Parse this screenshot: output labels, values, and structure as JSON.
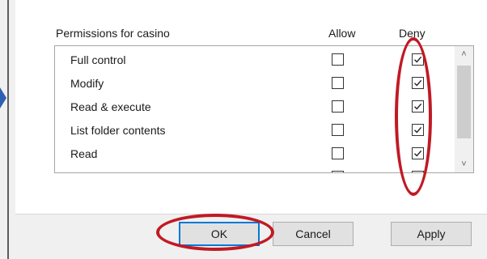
{
  "permissions": {
    "title": "Permissions for casino",
    "allow_header": "Allow",
    "deny_header": "Deny",
    "rows": [
      {
        "name": "Full control",
        "allow": false,
        "deny": true
      },
      {
        "name": "Modify",
        "allow": false,
        "deny": true
      },
      {
        "name": "Read & execute",
        "allow": false,
        "deny": true
      },
      {
        "name": "List folder contents",
        "allow": false,
        "deny": true
      },
      {
        "name": "Read",
        "allow": false,
        "deny": true
      },
      {
        "name": "",
        "allow": false,
        "deny": false
      }
    ]
  },
  "buttons": {
    "ok": "OK",
    "cancel": "Cancel",
    "apply": "Apply"
  },
  "colors": {
    "annotation_red": "#c01a24",
    "pointer_blue": "#2f5fb5",
    "focus_blue": "#0078d7"
  },
  "icons": {
    "scroll_up": "chevron-up-icon",
    "scroll_down": "chevron-down-icon",
    "checkmark": "checkmark-icon"
  }
}
